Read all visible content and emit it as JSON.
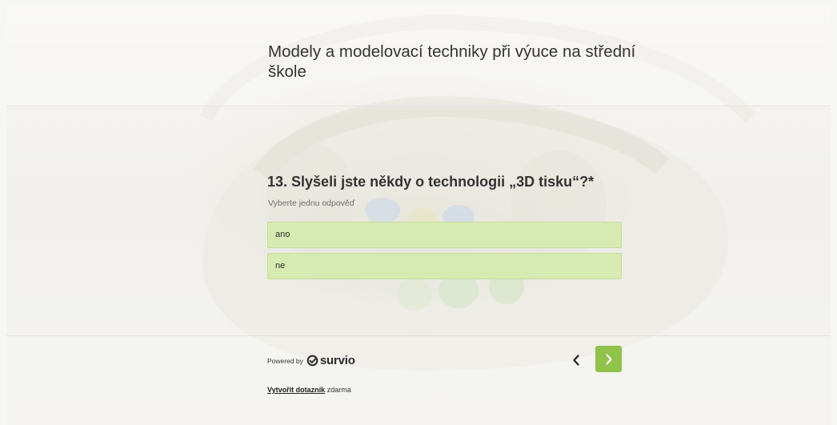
{
  "survey": {
    "title": "Modely a modelovací techniky při výuce na střední škole"
  },
  "question": {
    "text": "13. Slyšeli jste někdy o technologii „3D tisku“?*",
    "hint": "Vyberte jednu odpověď",
    "options": [
      {
        "label": "ano"
      },
      {
        "label": "ne"
      }
    ]
  },
  "footer": {
    "powered_by": "Powered by",
    "brand": "survio",
    "create_link": "Vytvořit dotazník",
    "create_suffix": " zdarma"
  },
  "colors": {
    "option_bg": "#d7eab1",
    "accent": "#8fc34a"
  },
  "icons": {
    "prev": "chevron-left-icon",
    "next": "chevron-right-icon",
    "logo": "survio-logo-icon"
  }
}
